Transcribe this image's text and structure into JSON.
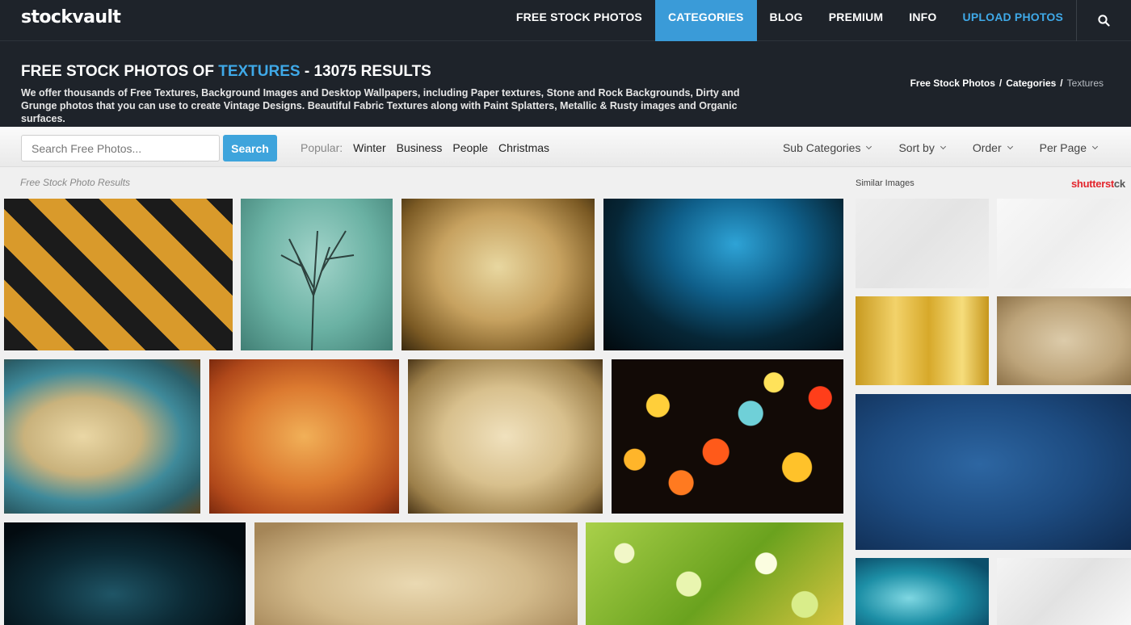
{
  "site": {
    "logo": "stockvault"
  },
  "nav": {
    "items": [
      "FREE STOCK PHOTOS",
      "CATEGORIES",
      "BLOG",
      "PREMIUM",
      "INFO",
      "UPLOAD PHOTOS"
    ],
    "active": "CATEGORIES",
    "search_icon": "search-icon"
  },
  "header": {
    "title_prefix": "FREE STOCK PHOTOS OF",
    "title_highlight": "TEXTURES",
    "title_suffix": "- 13075 RESULTS",
    "description": "We offer thousands of Free Textures, Background Images and Desktop Wallpapers, including Paper textures, Stone and Rock Backgrounds, Dirty and Grunge photos that you can use to create Vintage Designs. Beautiful Fabric Textures along with Paint Splatters, Metallic & Rusty images and Organic surfaces.",
    "breadcrumb": {
      "home": "Free Stock Photos",
      "section": "Categories",
      "current": "Textures",
      "separator": "/"
    }
  },
  "toolbar": {
    "search_placeholder": "Search Free Photos...",
    "search_value": "",
    "search_button": "Search",
    "popular_label": "Popular:",
    "popular_tags": [
      "Winter",
      "Business",
      "People",
      "Christmas"
    ],
    "filters": [
      "Sub Categories",
      "Sort by",
      "Order",
      "Per Page"
    ]
  },
  "results": {
    "label": "Free Stock Photo Results"
  },
  "sidebar": {
    "label": "Similar Images",
    "brand_red": "shutterst",
    "brand_gray": "ck"
  },
  "colors": {
    "nav_bg": "#1e232a",
    "accent": "#3a9bd8",
    "accent_text": "#3fa9e8",
    "shutterstock_red": "#e3252c"
  }
}
